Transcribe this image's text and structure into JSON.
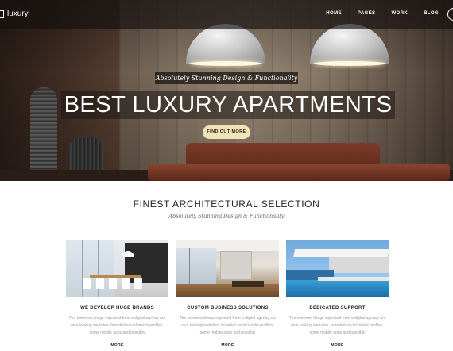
{
  "header": {
    "logo_text": "luxury",
    "nav": [
      "HOME",
      "PAGES",
      "WORK",
      "BLOG"
    ]
  },
  "hero": {
    "tagline": "Absolutely Stunning Design & Functionality",
    "headline": "BEST LUXURY APARTMENTS",
    "cta_label": "FIND OUT MORE"
  },
  "section": {
    "title": "FINEST ARCHITECTURAL SELECTION",
    "subtitle": "Absolutely Stunning Design & Functionality"
  },
  "cards": [
    {
      "title": "WE DEVELOP HUGE BRANDS",
      "text": "The common things expected from a digital agency are nice looking websites, branded social media profiles, some mobile apps and possibly",
      "more": "MORE"
    },
    {
      "title": "CUSTOM BUSINESS SOLUTIONS",
      "text": "The common things expected from a digital agency are nice looking websites, branded social media profiles, some mobile apps and possibly",
      "more": "MORE"
    },
    {
      "title": "DEDICATED SUPPORT",
      "text": "The common things expected from a digital agency are nice looking websites, branded social media profiles, some mobile apps and possibly",
      "more": "MORE"
    }
  ],
  "colors": {
    "cta_background": "#f1e4b8",
    "topbar": "#1f1a17",
    "body_text": "#9a9a9a"
  }
}
